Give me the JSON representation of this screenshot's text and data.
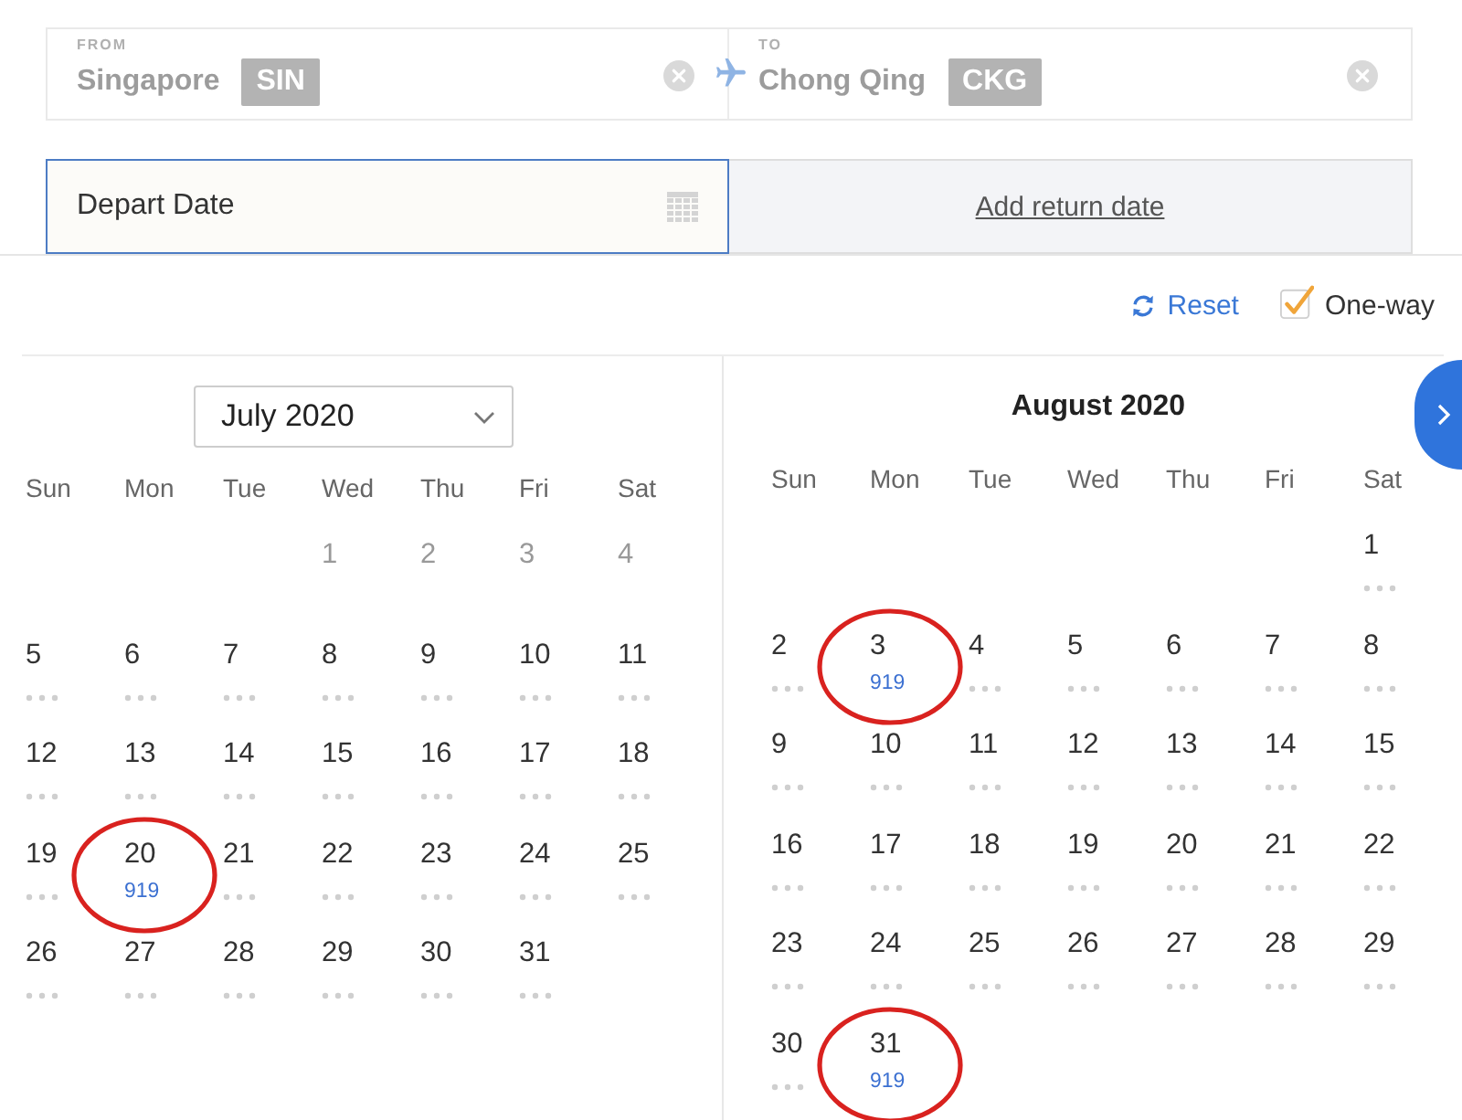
{
  "route": {
    "from": {
      "label": "FROM",
      "city": "Singapore",
      "code": "SIN"
    },
    "to": {
      "label": "TO",
      "city": "Chong Qing",
      "code": "CKG"
    }
  },
  "dates": {
    "depart": {
      "placeholder": "Depart Date"
    },
    "return_link": "Add return date"
  },
  "toolbar": {
    "reset": "Reset",
    "one_way": {
      "label": "One-way",
      "checked": true
    }
  },
  "months": [
    {
      "title": "July 2020",
      "kind": "dropdown",
      "weekdays": [
        "Sun",
        "Mon",
        "Tue",
        "Wed",
        "Thu",
        "Fri",
        "Sat"
      ],
      "weeks": [
        [
          {
            "date": "1",
            "disabled": true,
            "circled": false
          },
          {
            "date": "2",
            "disabled": true,
            "circled": false
          },
          {
            "date": "3",
            "disabled": true,
            "circled": false
          },
          {
            "date": "4",
            "disabled": true,
            "circled": false
          }
        ],
        [
          {
            "date": "5",
            "disabled": false,
            "circled": false
          },
          {
            "date": "6",
            "disabled": false,
            "circled": false
          },
          {
            "date": "7",
            "disabled": false,
            "circled": false
          },
          {
            "date": "8",
            "disabled": false,
            "circled": false
          },
          {
            "date": "9",
            "disabled": false,
            "circled": false
          },
          {
            "date": "10",
            "disabled": false,
            "circled": false
          },
          {
            "date": "11",
            "disabled": false,
            "circled": false
          }
        ],
        [
          {
            "date": "12",
            "disabled": false,
            "circled": false
          },
          {
            "date": "13",
            "disabled": false,
            "circled": false
          },
          {
            "date": "14",
            "disabled": false,
            "circled": false
          },
          {
            "date": "15",
            "disabled": false,
            "circled": false
          },
          {
            "date": "16",
            "disabled": false,
            "circled": false
          },
          {
            "date": "17",
            "disabled": false,
            "circled": false
          },
          {
            "date": "18",
            "disabled": false,
            "circled": false
          }
        ],
        [
          {
            "date": "19",
            "disabled": false,
            "circled": false
          },
          {
            "date": "20",
            "disabled": false,
            "circled": true,
            "price": "919"
          },
          {
            "date": "21",
            "disabled": false,
            "circled": false
          },
          {
            "date": "22",
            "disabled": false,
            "circled": false
          },
          {
            "date": "23",
            "disabled": false,
            "circled": false
          },
          {
            "date": "24",
            "disabled": false,
            "circled": false
          },
          {
            "date": "25",
            "disabled": false,
            "circled": false
          }
        ],
        [
          {
            "date": "26",
            "disabled": false,
            "circled": false
          },
          {
            "date": "27",
            "disabled": false,
            "circled": false
          },
          {
            "date": "28",
            "disabled": false,
            "circled": false
          },
          {
            "date": "29",
            "disabled": false,
            "circled": false
          },
          {
            "date": "30",
            "disabled": false,
            "circled": false
          },
          {
            "date": "31",
            "disabled": false,
            "circled": false
          }
        ]
      ]
    },
    {
      "title": "August 2020",
      "kind": "title",
      "weekdays": [
        "Sun",
        "Mon",
        "Tue",
        "Wed",
        "Thu",
        "Fri",
        "Sat"
      ],
      "weeks": [
        [
          {
            "date": "1",
            "disabled": false,
            "circled": false
          }
        ],
        [
          {
            "date": "2",
            "disabled": false,
            "circled": false
          },
          {
            "date": "3",
            "disabled": false,
            "circled": true,
            "price": "919"
          },
          {
            "date": "4",
            "disabled": false,
            "circled": false
          },
          {
            "date": "5",
            "disabled": false,
            "circled": false
          },
          {
            "date": "6",
            "disabled": false,
            "circled": false
          },
          {
            "date": "7",
            "disabled": false,
            "circled": false
          },
          {
            "date": "8",
            "disabled": false,
            "circled": false
          }
        ],
        [
          {
            "date": "9",
            "disabled": false,
            "circled": false
          },
          {
            "date": "10",
            "disabled": false,
            "circled": false
          },
          {
            "date": "11",
            "disabled": false,
            "circled": false
          },
          {
            "date": "12",
            "disabled": false,
            "circled": false
          },
          {
            "date": "13",
            "disabled": false,
            "circled": false
          },
          {
            "date": "14",
            "disabled": false,
            "circled": false
          },
          {
            "date": "15",
            "disabled": false,
            "circled": false
          }
        ],
        [
          {
            "date": "16",
            "disabled": false,
            "circled": false
          },
          {
            "date": "17",
            "disabled": false,
            "circled": false
          },
          {
            "date": "18",
            "disabled": false,
            "circled": false
          },
          {
            "date": "19",
            "disabled": false,
            "circled": false
          },
          {
            "date": "20",
            "disabled": false,
            "circled": false
          },
          {
            "date": "21",
            "disabled": false,
            "circled": false
          },
          {
            "date": "22",
            "disabled": false,
            "circled": false
          }
        ],
        [
          {
            "date": "23",
            "disabled": false,
            "circled": false
          },
          {
            "date": "24",
            "disabled": false,
            "circled": false
          },
          {
            "date": "25",
            "disabled": false,
            "circled": false
          },
          {
            "date": "26",
            "disabled": false,
            "circled": false
          },
          {
            "date": "27",
            "disabled": false,
            "circled": false
          },
          {
            "date": "28",
            "disabled": false,
            "circled": false
          },
          {
            "date": "29",
            "disabled": false,
            "circled": false
          }
        ],
        [
          {
            "date": "30",
            "disabled": false,
            "circled": false
          },
          {
            "date": "31",
            "disabled": false,
            "circled": true,
            "price": "919"
          }
        ]
      ]
    }
  ]
}
